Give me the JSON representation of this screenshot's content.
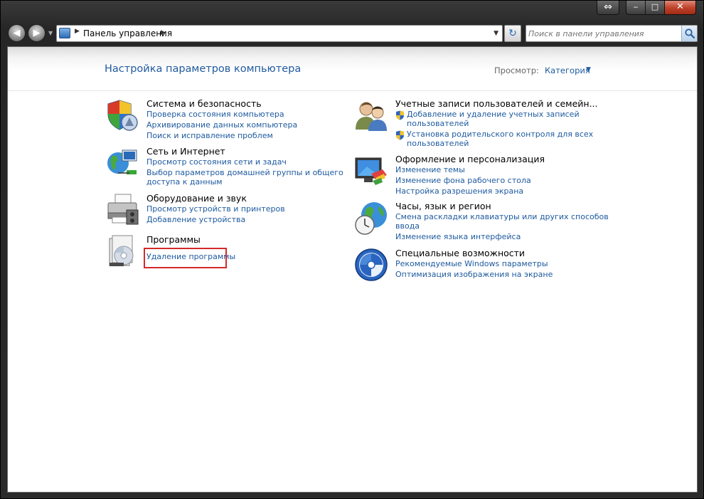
{
  "window": {
    "nav": {
      "back_glyph": "◀",
      "forward_glyph": "▶",
      "history_glyph": "▼"
    },
    "address": {
      "arrow1": "▶",
      "path": "Панель управления",
      "arrow2": "▶",
      "dropdown": "▼"
    },
    "refresh_glyph": "↻",
    "search": {
      "placeholder": "Поиск в панели управления"
    },
    "caption": {
      "minimize": "‒",
      "maximize": "□",
      "close": "✕",
      "resize": "⇔"
    }
  },
  "header": {
    "title": "Настройка параметров компьютера",
    "view_label": "Просмотр:",
    "view_value": "Категория",
    "view_caret": "▼"
  },
  "categories": {
    "system": {
      "title": "Система и безопасность",
      "icon": "shield-icon",
      "links": [
        "Проверка состояния компьютера",
        "Архивирование данных компьютера",
        "Поиск и исправление проблем"
      ]
    },
    "network": {
      "title": "Сеть и Интернет",
      "icon": "network-globe-icon",
      "links": [
        "Просмотр состояния сети и задач",
        "Выбор параметров домашней группы и общего",
        "доступа к данным"
      ]
    },
    "hardware": {
      "title": "Оборудование и звук",
      "icon": "printer-icon",
      "links": [
        "Просмотр устройств и принтеров",
        "Добавление устройства"
      ]
    },
    "programs": {
      "title": "Программы",
      "icon": "programs-disc-icon",
      "links": [
        "Удаление программы"
      ]
    },
    "accounts": {
      "title": "Учетные записи пользователей и семейн...",
      "icon": "users-icon",
      "links": [
        "Добавление и удаление учетных записей",
        "пользователей",
        "Установка родительского контроля для всех",
        "пользователей"
      ]
    },
    "appearance": {
      "title": "Оформление и персонализация",
      "icon": "monitor-paint-icon",
      "links": [
        "Изменение темы",
        "Изменение фона рабочего стола",
        "Настройка разрешения экрана"
      ]
    },
    "clock": {
      "title": "Часы, язык и регион",
      "icon": "globe-clock-icon",
      "links": [
        "Смена раскладки клавиатуры или других способов",
        "ввода",
        "Изменение языка интерфейса"
      ]
    },
    "access": {
      "title": "Специальные возможности",
      "icon": "ease-of-access-icon",
      "links": [
        "Рекомендуемые Windows параметры",
        "Оптимизация изображения на экране"
      ]
    }
  },
  "colors": {
    "link": "#1e5a9f",
    "highlight": "#d42a2a"
  }
}
